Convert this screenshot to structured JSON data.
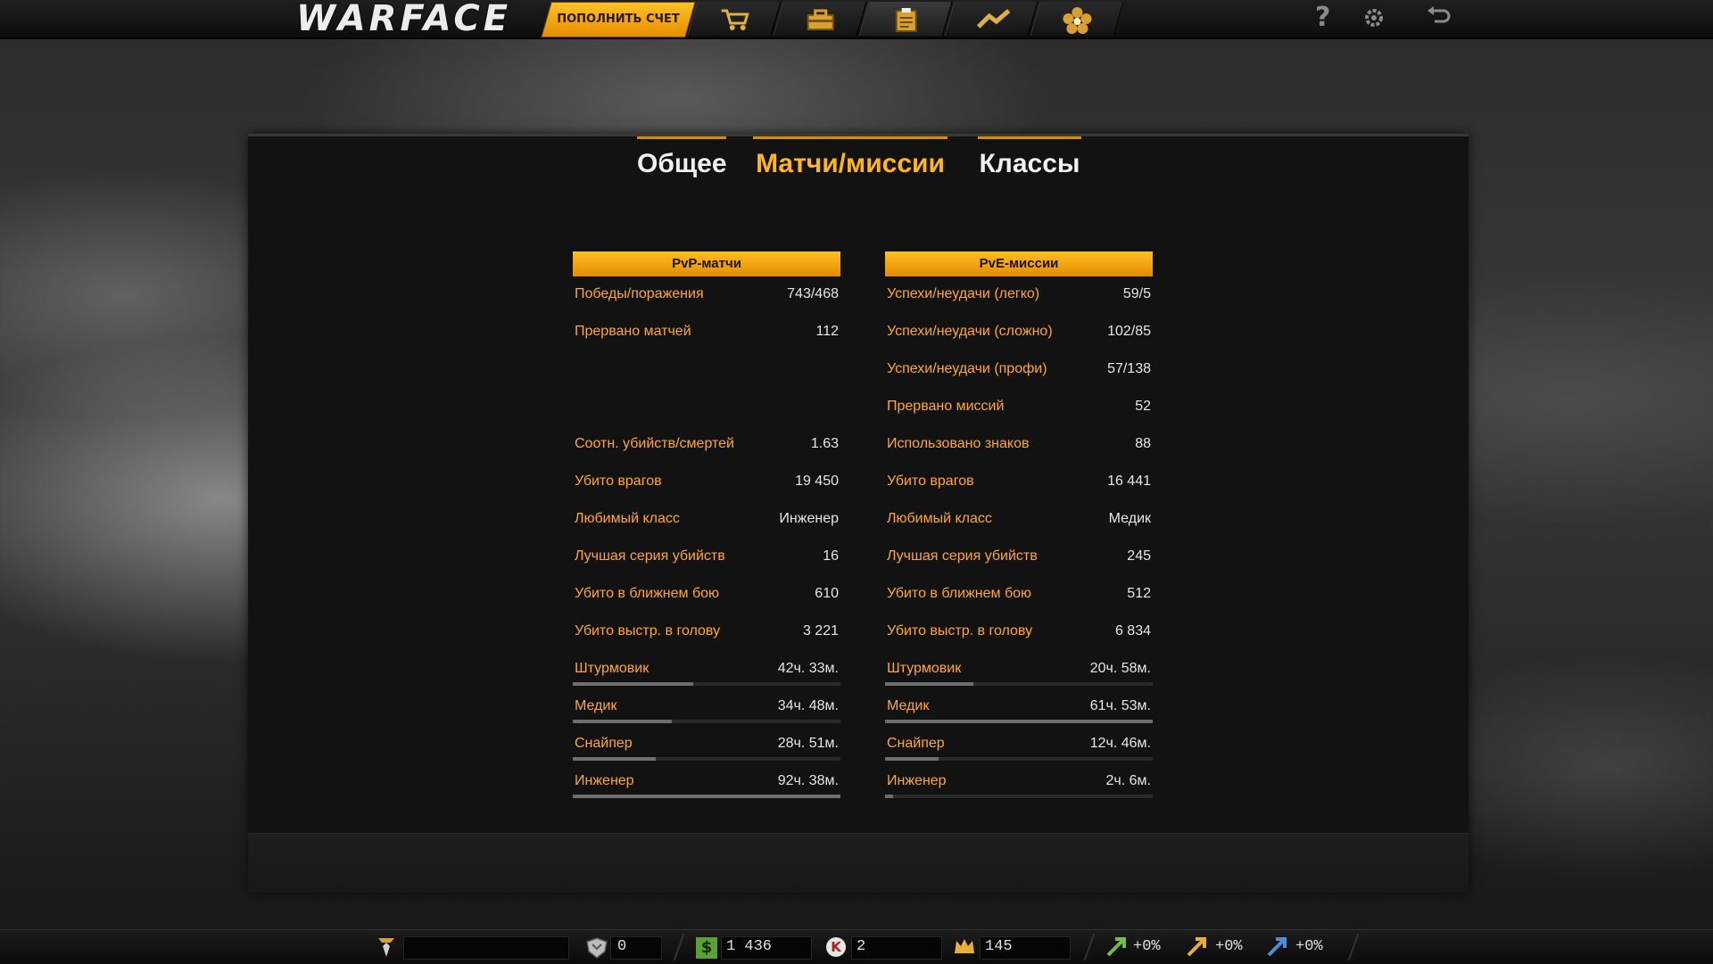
{
  "topbar": {
    "logo": "WARFACE",
    "topup_label": "ПОПОЛНИТЬ СЧЕТ",
    "nav_icons": [
      "shop-cart-icon",
      "inventory-box-icon",
      "stats-clipboard-icon",
      "rank-chevron-icon",
      "achievements-flower-icon"
    ],
    "right_icons": [
      "help-icon",
      "settings-gear-icon",
      "exit-icon"
    ],
    "help_glyph": "?"
  },
  "tabs": [
    {
      "label": "Общее",
      "active": false
    },
    {
      "label": "Матчи/миссии",
      "active": true
    },
    {
      "label": "Классы",
      "active": false
    }
  ],
  "pvp": {
    "header": "PvP-матчи",
    "rows": [
      {
        "label": "Победы/поражения",
        "value": "743/468"
      },
      {
        "label": "Прервано матчей",
        "value": "112"
      },
      {
        "label": "Соотн. убийств/смертей",
        "value": "1.63"
      },
      {
        "label": "Убито врагов",
        "value": "19 450"
      },
      {
        "label": "Любимый класс",
        "value": "Инженер"
      },
      {
        "label": "Лучшая серия убийств",
        "value": "16"
      },
      {
        "label": "Убито в ближнем бою",
        "value": "610"
      },
      {
        "label": "Убито выстр. в голову",
        "value": "3 221"
      }
    ],
    "classes": [
      {
        "label": "Штурмовик",
        "value": "42ч. 33м.",
        "fraction": 0.45
      },
      {
        "label": "Медик",
        "value": "34ч. 48м.",
        "fraction": 0.37
      },
      {
        "label": "Снайпер",
        "value": "28ч. 51м.",
        "fraction": 0.31
      },
      {
        "label": "Инженер",
        "value": "92ч. 38м.",
        "fraction": 1.0
      }
    ]
  },
  "pve": {
    "header": "PvE-миссии",
    "rows": [
      {
        "label": "Успехи/неудачи (легко)",
        "value": "59/5"
      },
      {
        "label": "Успехи/неудачи (сложно)",
        "value": "102/85"
      },
      {
        "label": "Успехи/неудачи (профи)",
        "value": "57/138"
      },
      {
        "label": "Прервано миссий",
        "value": "52"
      },
      {
        "label": "Использовано знаков",
        "value": "88"
      },
      {
        "label": "Убито врагов",
        "value": "16 441"
      },
      {
        "label": "Любимый класс",
        "value": "Медик"
      },
      {
        "label": "Лучшая серия убийств",
        "value": "245"
      },
      {
        "label": "Убито в ближнем бою",
        "value": "512"
      },
      {
        "label": "Убито выстр. в голову",
        "value": "6 834"
      }
    ],
    "classes": [
      {
        "label": "Штурмовик",
        "value": "20ч. 58м.",
        "fraction": 0.33
      },
      {
        "label": "Медик",
        "value": "61ч. 53м.",
        "fraction": 1.0
      },
      {
        "label": "Снайпер",
        "value": "12ч. 46м.",
        "fraction": 0.2
      },
      {
        "label": "Инженер",
        "value": "2ч. 6м.",
        "fraction": 0.03
      }
    ]
  },
  "bottombar": {
    "rank_value": "",
    "crowns_box_value": "0",
    "money_value": "1 436",
    "kredits_value": "2",
    "crowns_value": "145",
    "boosters": [
      "+0%",
      "+0%",
      "+0%"
    ],
    "kredit_glyph": "K",
    "money_glyph": "$"
  },
  "colors": {
    "accent": "#ffb619",
    "label": "#ffa826",
    "value": "#e6e6e6"
  }
}
